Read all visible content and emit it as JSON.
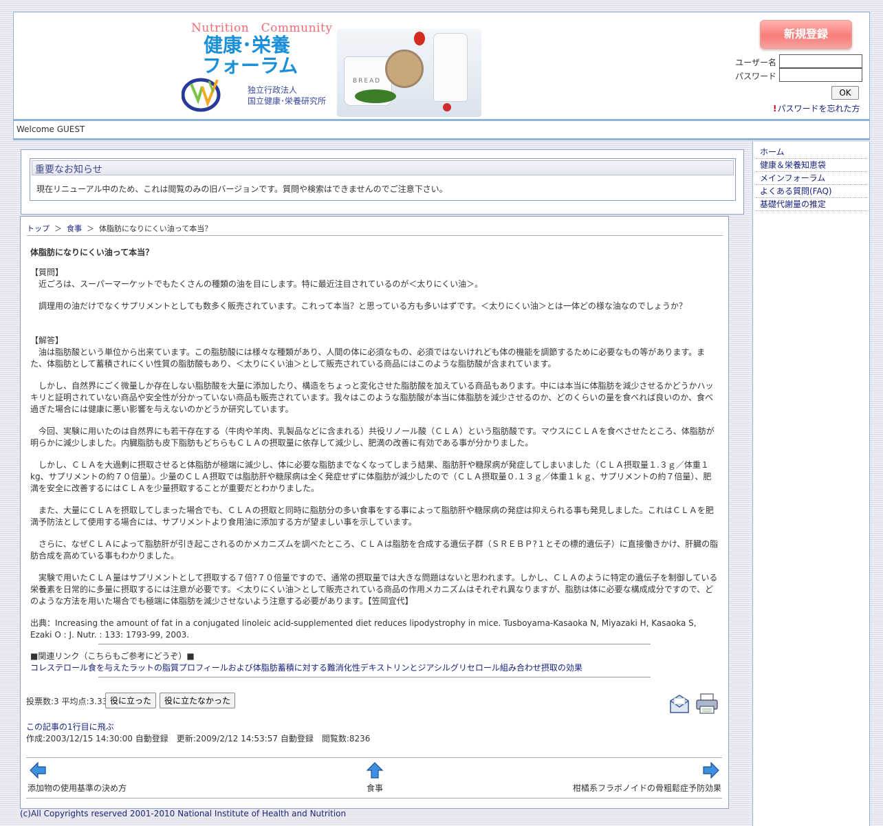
{
  "header": {
    "logo": {
      "en": "Nutrition　Community",
      "jp_line1": "健康･栄養",
      "jp_line2": "フォーラム",
      "org_line1": "独立行政法人",
      "org_line2": "国立健康･栄養研究所",
      "kitchen_label": "BREAD"
    },
    "register_label": "新規登録",
    "username_label": "ユーザー名",
    "password_label": "パスワード",
    "username_value": "",
    "password_value": "",
    "ok_label": "OK",
    "forgot_mark": "!",
    "forgot_label": "パスワードを忘れた方"
  },
  "welcome": "Welcome GUEST",
  "menu": [
    {
      "label": "ホーム"
    },
    {
      "label": "健康＆栄養知恵袋"
    },
    {
      "label": "メインフォーラム"
    },
    {
      "label": "よくある質問(FAQ)"
    },
    {
      "label": "基礎代謝量の推定"
    }
  ],
  "notice": {
    "title": "重要なお知らせ",
    "text": "現在リニューアル中のため、これは閲覧のみの旧バージョンです。質問や検索はできませんのでご注意下さい。"
  },
  "breadcrumb": {
    "top": "トップ",
    "sep": "＞",
    "category": "食事",
    "current": "体脂肪になりにくい油って本当？"
  },
  "article": {
    "title": "体脂肪になりにくい油って本当？",
    "question_heading": "【質問】",
    "question": [
      "　近ごろは、スーパーマーケットでもたくさんの種類の油を目にします。特に最近注目されているのが＜太りにくい油＞。",
      "　調理用の油だけでなくサプリメントとしても数多く販売されています。これって本当？と思っている方も多いはずです。＜太りにくい油＞とは一体どの様な油なのでしょうか？"
    ],
    "answer_heading": "【解答】",
    "answer": [
      "　油は脂肪酸という単位から出来ています。この脂肪酸には様々な種類があり、人間の体に必須なもの、必須ではないけれども体の機能を調節するために必要なもの等があります。また、体脂肪として蓄積されにくい性質の脂肪酸もあり、＜太りにくい油＞として販売されている商品にはこのような脂肪酸が含まれています。",
      "　しかし、自然界にごく微量しか存在しない脂肪酸を大量に添加したり、構造をちょっと変化させた脂肪酸を加えている商品もあります。中には本当に体脂肪を減少させるかどうかハッキリと証明されていない商品や安全性が分かっていない商品も販売されています。我々はこのような脂肪酸が本当に体脂肪を減少させるのか、どのくらいの量を食べれば良いのか、食べ過ぎた場合には健康に悪い影響を与えないのかどうか研究しています。",
      "　今回、実験に用いたのは自然界にも若干存在する（牛肉や羊肉、乳製品などに含まれる）共役リノール酸（ＣＬＡ）という脂肪酸です。マウスにＣＬＡを食べさせたところ、体脂肪が明らかに減少しました。内臓脂肪も皮下脂肪もどちらもＣＬＡの摂取量に依存して減少し、肥満の改善に有効である事が分かりました。",
      "　しかし、ＣＬＡを大過剰に摂取させると体脂肪が極端に減少し、体に必要な脂肪までなくなってしまう結果、脂肪肝や糖尿病が発症してしまいました（ＣＬＡ摂取量１.３ｇ／体重１kg、サプリメントの約７０倍量）。少量のＣＬＡ摂取では脂肪肝や糖尿病は全く発症せずに体脂肪が減少したので（ＣＬＡ摂取量０.１３ｇ／体重１ｋｇ、サプリメントの約７倍量）、肥満を安全に改善するにはＣＬＡを少量摂取することが重要だとわかりました。",
      "　また、大量にＣＬＡを摂取してしまった場合でも、ＣＬＡの摂取と同時に脂肪分の多い食事をする事によって脂肪肝や糖尿病の発症は抑えられる事も発見しました。これはＣＬＡを肥満予防法として使用する場合には、サプリメントより食用油に添加する方が望ましい事を示しています。",
      "　さらに、なぜＣＬＡによって脂肪肝が引き起こされるのかメカニズムを調べたところ、ＣＬＡは脂肪を合成する遺伝子群（ＳＲＥＢＰ?１とその標的遺伝子）に直接働きかけ、肝臓の脂肪合成を高めている事もわかりました。",
      "　実験で用いたＣＬＡ量はサプリメントとして摂取する７倍?７０倍量ですので、通常の摂取量では大きな問題はないと思われます。しかし、ＣＬＡのように特定の遺伝子を制御している栄養素を日常的に多量に摂取するには注意が必要です。＜太りにくい油＞として販売されている商品の作用メカニズムはそれぞれ異なりますが、脂肪は体に必要な構成成分ですので、どのような方法を用いた場合でも極端に体脂肪を減少させないよう注意する必要があります。【笠岡宜代】"
    ],
    "source": "出典：Increasing the amount of fat in a conjugated linoleic acid-supplemented diet reduces lipodystrophy in mice. Tusboyama-Kasaoka N, Miyazaki H, Kasaoka S, Ezaki O : J. Nutr. : 133: 1793-99, 2003.",
    "related_label": "■関連リンク（こちらもご参考にどうぞ）■",
    "related_link": "コレステロール食を与えたラットの脂質プロフィールおよび体脂肪蓄積に対する難消化性デキストリンとジアシルグリセロール組み合わせ摂取の効果"
  },
  "vote": {
    "text": "投票数:3 平均点:3.33",
    "helpful_label": "役に立った",
    "not_helpful_label": "役に立たなかった"
  },
  "jump_top": "この記事の1行目に飛ぶ",
  "meta": "作成:2003/12/15 14:30:00 自動登録　更新:2009/2/12 14:53:57 自動登録　閲覧数:8236",
  "nav": {
    "prev_label": "添加物の使用基準の決め方",
    "up_label": "食事",
    "next_label": "柑橘系フラボノイドの骨粗鬆症予防効果"
  },
  "footer": "(c)All Copyrights reserved 2001-2010 National Institute of Health and Nutrition",
  "colors": {
    "link": "#1a237e",
    "border": "#8ab4d8",
    "register": "#f77d78",
    "nav_arrow": "#1e88e5"
  }
}
